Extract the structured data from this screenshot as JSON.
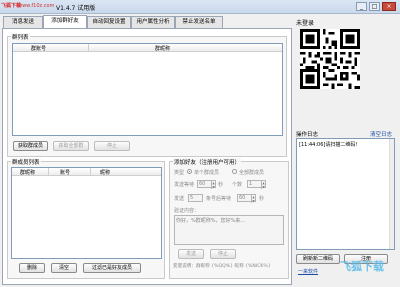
{
  "window": {
    "logo": "飞狐下载",
    "site": "www.f10z.com",
    "title": "V1.4.7 试用版",
    "min_label": "_",
    "max_label": "□",
    "close_label": "×"
  },
  "tabs": [
    "消息发送",
    "添加群好友",
    "自动回复设置",
    "用户属性分析",
    "禁止发送名单"
  ],
  "groups": {
    "title": "群列表",
    "columns": [
      "群账号",
      "群昵称"
    ],
    "fetch_button": "获取群成员",
    "fetch_all_button": "获取全部群",
    "stop_button": "停止"
  },
  "members": {
    "title": "群成员列表",
    "columns": [
      "群昵称",
      "账号",
      "昵称"
    ],
    "delete_button": "删除",
    "clear_button": "清空",
    "filter_button": "过滤已是好友成员"
  },
  "add_friend": {
    "title": "添加好友（注册用户可用）",
    "type_label": "类型",
    "single_label": "单个群成员",
    "all_label": "全部群成员",
    "interval_label": "发送等待",
    "interval_value": "60",
    "interval_unit": "秒",
    "count_label": "个数",
    "count_value": "1",
    "send_label": "发送",
    "send_value": "5",
    "wait_label": "条号后等待",
    "wait_value": "60",
    "wait_unit": "秒",
    "verify_label": "验证内容：",
    "verify_text": "你好，%群昵称%，您好%来...",
    "send_button": "发送",
    "stop_button": "停止",
    "vars_text": "变量说明：群昵称 {%QQ%} 昵称 {%NICK%}"
  },
  "right": {
    "login_status": "未登录",
    "log_title": "操作日志",
    "clear_log": "清空日志",
    "log_entry": "[11:44:06]请扫描二维码!",
    "refresh_qr_button": "刷新新二维码",
    "register_button": "注册",
    "footer_link": "一来软件"
  },
  "watermark": "飞狐下载"
}
